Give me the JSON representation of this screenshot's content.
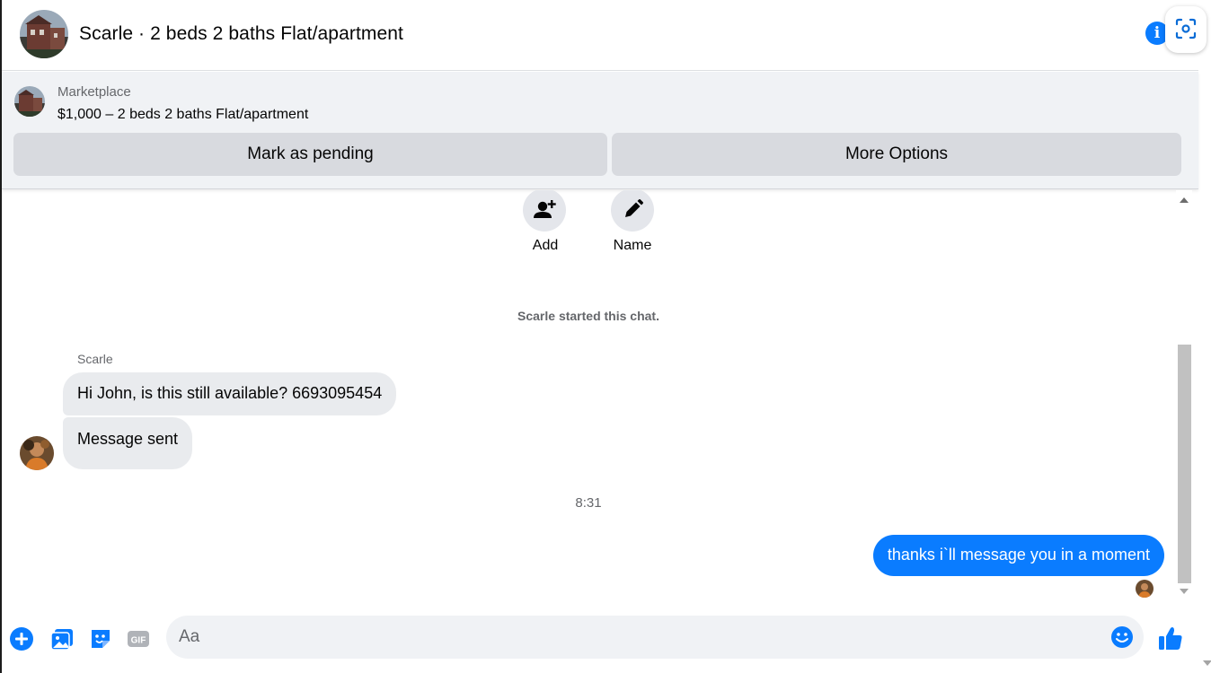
{
  "header": {
    "title": "Scarle · 2 beds 2 baths Flat/apartment",
    "info_icon": "info-icon",
    "lens_icon": "visual-search-icon"
  },
  "marketplace": {
    "source": "Marketplace",
    "listing": "$1,000 – 2 beds 2 baths Flat/apartment",
    "mark_pending_label": "Mark as pending",
    "more_options_label": "More Options"
  },
  "chat_actions": {
    "add_label": "Add",
    "name_label": "Name"
  },
  "messages": {
    "system_notice": "Scarle started this chat.",
    "sender_name": "Scarle",
    "incoming": [
      "Hi John, is this still available? 6693095454",
      "Message sent"
    ],
    "timestamp": "8:31",
    "outgoing": "thanks i`ll message you in a moment"
  },
  "composer": {
    "placeholder": "Aa",
    "value": ""
  },
  "colors": {
    "accent": "#0a7cff",
    "bubble_incoming": "#e9ebee",
    "panel_bg": "#f0f2f5",
    "button_bg": "#d8dadf"
  }
}
